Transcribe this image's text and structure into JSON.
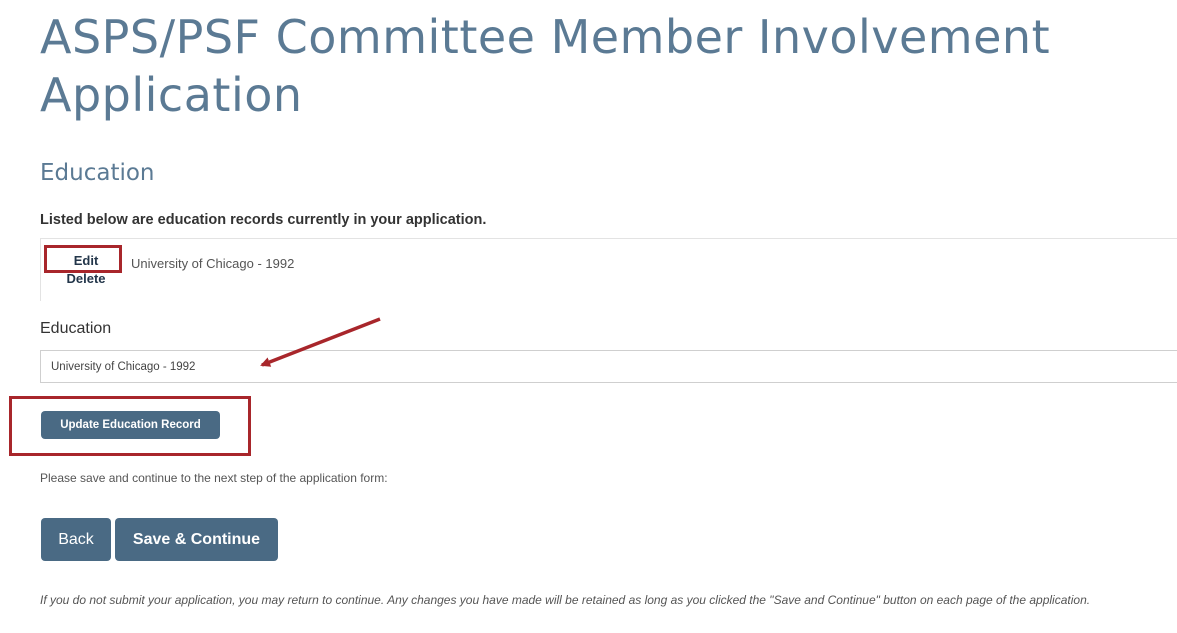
{
  "page": {
    "title": "ASPS/PSF Committee Member Involvement Application"
  },
  "education_section": {
    "heading": "Education",
    "intro": "Listed below are education records currently in your application.",
    "records": [
      {
        "edit_label": "Edit",
        "delete_label": "Delete",
        "text": "University of Chicago - 1992"
      }
    ],
    "field_label": "Education",
    "field_value": "University of Chicago - 1992",
    "update_button": "Update Education Record"
  },
  "navigation": {
    "note": "Please save and continue to the next step of the application form:",
    "back_button": "Back",
    "save_button": "Save & Continue"
  },
  "footnote": "If you do not submit your application, you may return to continue. Any changes you have made will be retained as long as you clicked the \"Save and Continue\" button on each page of the application.",
  "colors": {
    "title": "#5b7a94",
    "button": "#4a6a84",
    "highlight": "#a8262b"
  }
}
